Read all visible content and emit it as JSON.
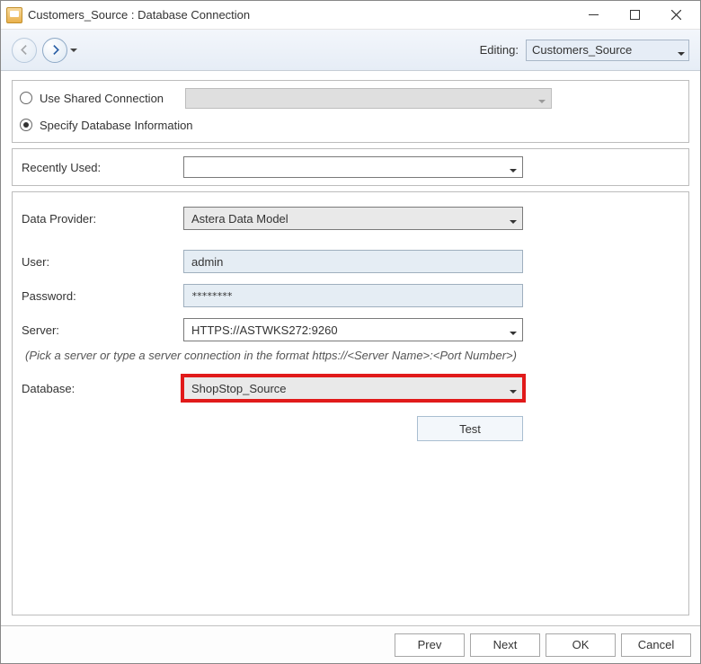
{
  "window": {
    "title": "Customers_Source : Database Connection"
  },
  "nav": {
    "editing_label": "Editing:",
    "editing_value": "Customers_Source"
  },
  "connection_mode": {
    "shared_label": "Use Shared Connection",
    "specify_label": "Specify Database Information",
    "selected": "specify"
  },
  "recent": {
    "label": "Recently Used:",
    "value": ""
  },
  "form": {
    "data_provider": {
      "label": "Data Provider:",
      "value": "Astera Data Model"
    },
    "user": {
      "label": "User:",
      "value": "admin"
    },
    "password": {
      "label": "Password:",
      "mask": "********"
    },
    "server": {
      "label": "Server:",
      "value": "HTTPS://ASTWKS272:9260",
      "hint": "(Pick a server or type a server connection in the format  https://<Server Name>:<Port Number>)"
    },
    "database": {
      "label": "Database:",
      "value": "ShopStop_Source"
    },
    "test_label": "Test"
  },
  "footer": {
    "prev": "Prev",
    "next": "Next",
    "ok": "OK",
    "cancel": "Cancel"
  }
}
